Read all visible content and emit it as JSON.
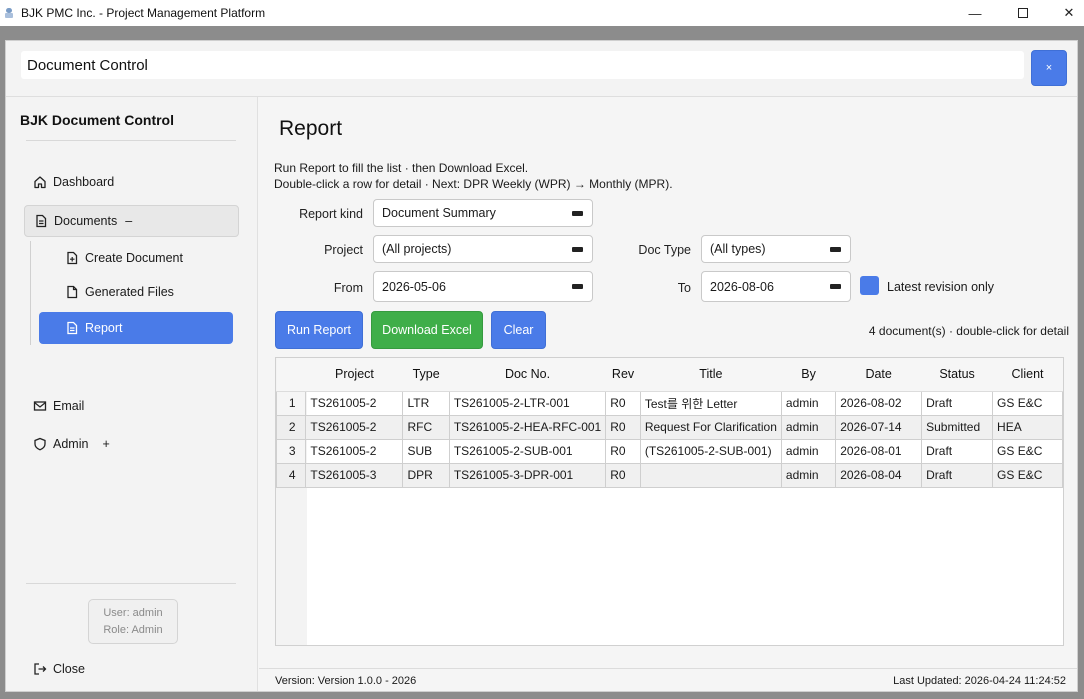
{
  "window": {
    "title": "BJK PMC Inc. - Project Management Platform",
    "minimize": "—",
    "close": "✕"
  },
  "dialog": {
    "title": "Document Control",
    "close_label": "×"
  },
  "sidebar": {
    "brand": "BJK Document Control",
    "items": [
      {
        "label": "Dashboard",
        "icon": "home-icon"
      },
      {
        "label": "Documents",
        "suffix": "–",
        "icon": "document-icon"
      },
      {
        "label": "Create Document",
        "icon": "file-plus-icon"
      },
      {
        "label": "Generated Files",
        "icon": "file-icon"
      },
      {
        "label": "Report",
        "icon": "report-icon",
        "active": true
      },
      {
        "label": "Email",
        "icon": "mail-icon"
      },
      {
        "label": "Admin",
        "suffix": "+",
        "icon": "shield-icon"
      }
    ],
    "user": "User: admin",
    "role": "Role: Admin",
    "close_label": "Close"
  },
  "report": {
    "title": "Report",
    "help_line1": "Run Report to fill the list · then Download Excel.",
    "help_line2": "Double-click a row for detail · Next: DPR Weekly (WPR) → Monthly (MPR).",
    "report_kind_label": "Report kind",
    "report_kind_value": "Document Summary",
    "project_label": "Project",
    "project_value": "(All projects)",
    "doc_type_label": "Doc Type",
    "doc_type_value": "(All types)",
    "from_label": "From",
    "from_value": "2026-05-06",
    "to_label": "To",
    "to_value": "2026-08-06",
    "latest_revision_label": "Latest revision only",
    "latest_revision_checked": true,
    "run_label": "Run Report",
    "download_label": "Download Excel",
    "clear_label": "Clear",
    "count_text": "4 document(s) · double-click for detail"
  },
  "table": {
    "columns": [
      "",
      "Project",
      "Type",
      "Doc No.",
      "Rev",
      "Title",
      "By",
      "Date",
      "Status",
      "Client"
    ],
    "rows": [
      [
        "1",
        "TS261005-2",
        "LTR",
        "TS261005-2-LTR-001",
        "R0",
        "Test를 위한 Letter",
        "admin",
        "2026-08-02",
        "Draft",
        "GS E&C"
      ],
      [
        "2",
        "TS261005-2",
        "RFC",
        "TS261005-2-HEA-RFC-001",
        "R0",
        "Request For Clarification",
        "admin",
        "2026-07-14",
        "Submitted",
        "HEA"
      ],
      [
        "3",
        "TS261005-2",
        "SUB",
        "TS261005-2-SUB-001",
        "R0",
        "(TS261005-2-SUB-001)",
        "admin",
        "2026-08-01",
        "Draft",
        "GS E&C"
      ],
      [
        "4",
        "TS261005-3",
        "DPR",
        "TS261005-3-DPR-001",
        "R0",
        "",
        "admin",
        "2026-08-04",
        "Draft",
        "GS E&C"
      ]
    ]
  },
  "footer": {
    "version": "Version: Version 1.0.0 - 2026",
    "last_updated": "Last Updated: 2026-04-24 11:24:52"
  },
  "colors": {
    "accent": "#4a7be8",
    "success": "#3fae49"
  }
}
